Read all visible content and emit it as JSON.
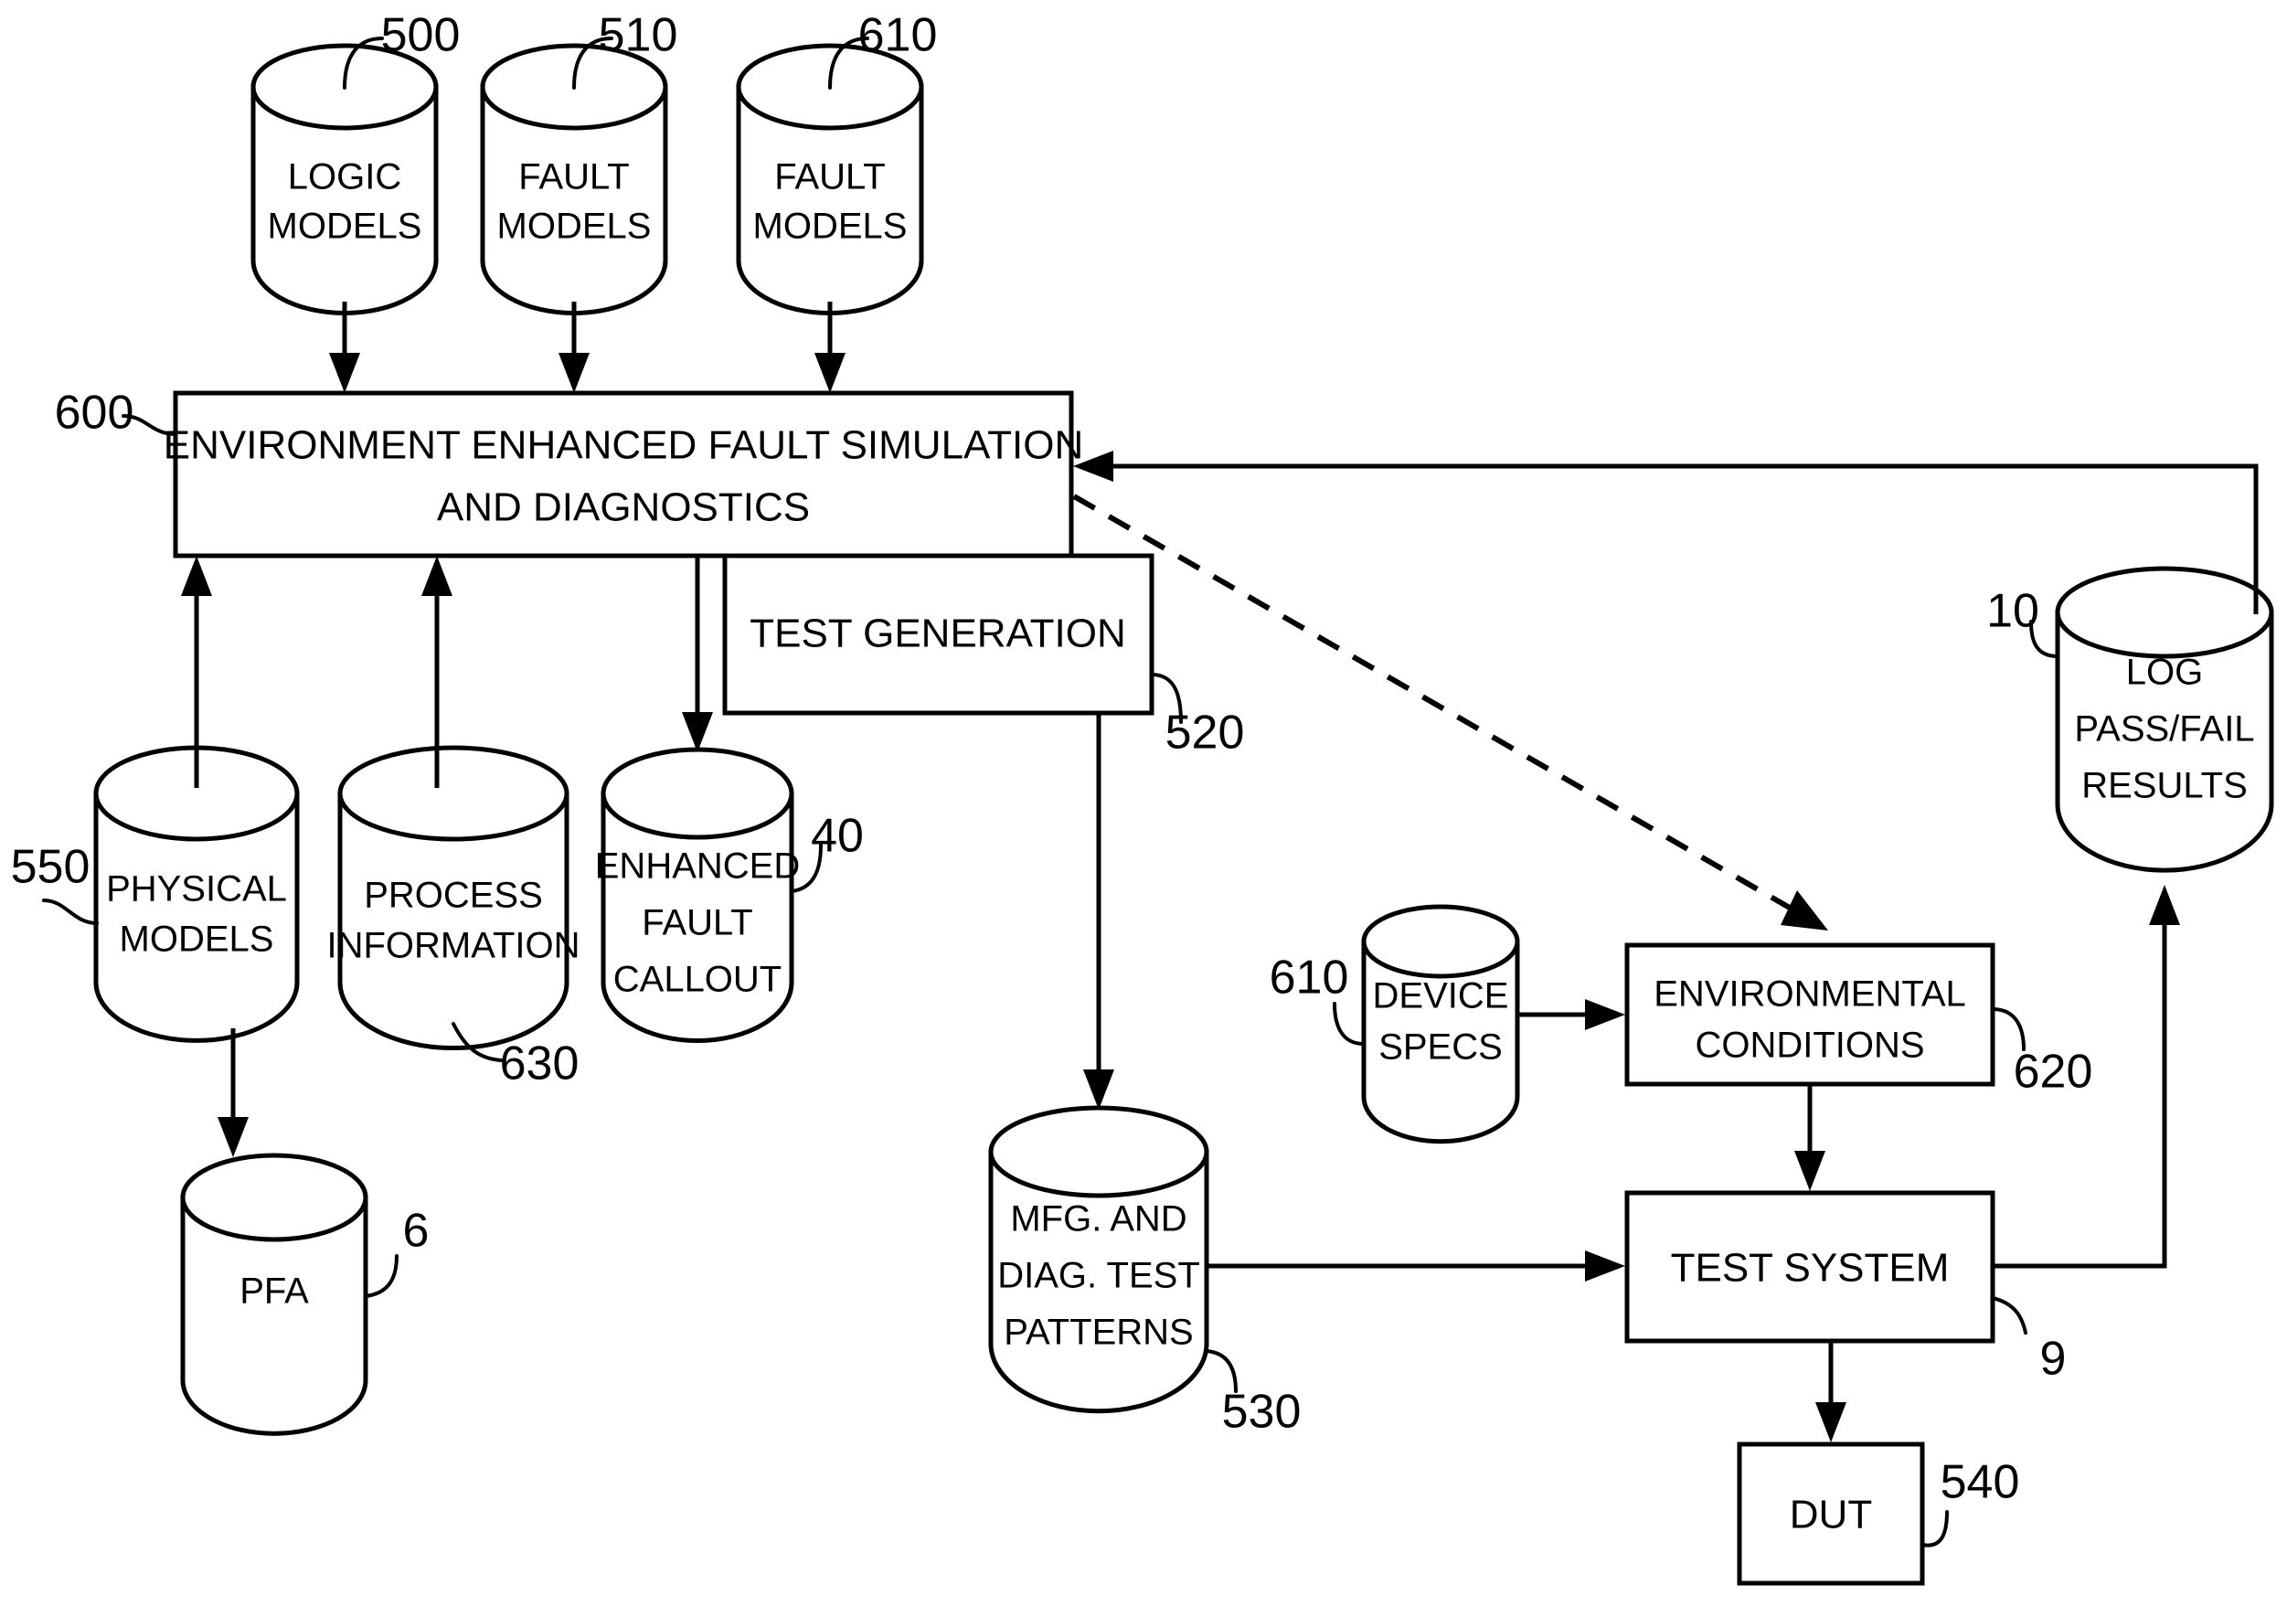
{
  "figure": {
    "type": "patent-flow-diagram",
    "background_color": "#ffffff",
    "line_color": "#000000"
  },
  "nodes": {
    "logic_models": {
      "label_line1": "LOGIC",
      "label_line2": "MODELS",
      "ref": "500",
      "shape": "cylinder"
    },
    "fault_models_510": {
      "label_line1": "FAULT",
      "label_line2": "MODELS",
      "ref": "510",
      "shape": "cylinder"
    },
    "fault_models_610": {
      "label_line1": "FAULT",
      "label_line2": "MODELS",
      "ref": "610",
      "shape": "cylinder"
    },
    "main_process": {
      "label_line1": "ENVIRONMENT ENHANCED FAULT SIMULATION",
      "label_line2": "AND DIAGNOSTICS",
      "ref": "600",
      "shape": "rectangle"
    },
    "test_generation": {
      "label_line1": "TEST GENERATION",
      "ref": "520",
      "shape": "rectangle"
    },
    "physical_models": {
      "label_line1": "PHYSICAL",
      "label_line2": "MODELS",
      "ref": "550",
      "shape": "cylinder"
    },
    "process_information": {
      "label_line1": "PROCESS",
      "label_line2": "INFORMATION",
      "ref": "630",
      "shape": "cylinder"
    },
    "enhanced_fault_callout": {
      "label_line1": "ENHANCED",
      "label_line2": "FAULT",
      "label_line3": "CALLOUT",
      "ref": "40",
      "shape": "cylinder"
    },
    "pfa": {
      "label_line1": "PFA",
      "ref": "6",
      "shape": "cylinder"
    },
    "test_patterns": {
      "label_line1": "MFG. AND",
      "label_line2": "DIAG. TEST",
      "label_line3": "PATTERNS",
      "ref": "530",
      "shape": "cylinder"
    },
    "device_specs": {
      "label_line1": "DEVICE",
      "label_line2": "SPECS",
      "ref": "610",
      "shape": "cylinder"
    },
    "environmental_conditions": {
      "label_line1": "ENVIRONMENTAL",
      "label_line2": "CONDITIONS",
      "ref": "620",
      "shape": "rectangle"
    },
    "test_system": {
      "label_line1": "TEST SYSTEM",
      "ref": "9",
      "shape": "rectangle"
    },
    "dut": {
      "label_line1": "DUT",
      "ref": "540",
      "shape": "rectangle"
    },
    "log_results": {
      "label_line1": "LOG",
      "label_line2": "PASS/FAIL",
      "label_line3": "RESULTS",
      "ref": "10",
      "shape": "cylinder"
    }
  },
  "edges": [
    {
      "from": "logic_models",
      "to": "main_process",
      "style": "solid",
      "arrow": "end"
    },
    {
      "from": "fault_models_510",
      "to": "main_process",
      "style": "solid",
      "arrow": "end"
    },
    {
      "from": "fault_models_610",
      "to": "main_process",
      "style": "solid",
      "arrow": "end"
    },
    {
      "from": "physical_models",
      "to": "main_process",
      "style": "solid",
      "arrow": "end"
    },
    {
      "from": "process_information",
      "to": "main_process",
      "style": "solid",
      "arrow": "end"
    },
    {
      "from": "main_process",
      "to": "enhanced_fault_callout",
      "style": "solid",
      "arrow": "end"
    },
    {
      "from": "physical_models",
      "to": "pfa",
      "style": "solid",
      "arrow": "end"
    },
    {
      "from": "test_generation",
      "to": "test_patterns",
      "style": "solid",
      "arrow": "end"
    },
    {
      "from": "test_patterns",
      "to": "test_system",
      "style": "solid",
      "arrow": "end"
    },
    {
      "from": "device_specs",
      "to": "environmental_conditions",
      "style": "solid",
      "arrow": "end"
    },
    {
      "from": "main_process",
      "to": "environmental_conditions",
      "style": "dashed",
      "arrow": "end"
    },
    {
      "from": "environmental_conditions",
      "to": "test_system",
      "style": "solid",
      "arrow": "end"
    },
    {
      "from": "test_system",
      "to": "dut",
      "style": "solid",
      "arrow": "end"
    },
    {
      "from": "test_system",
      "to": "log_results",
      "style": "solid",
      "arrow": "end"
    },
    {
      "from": "log_results",
      "to": "main_process",
      "style": "solid",
      "arrow": "end"
    }
  ]
}
